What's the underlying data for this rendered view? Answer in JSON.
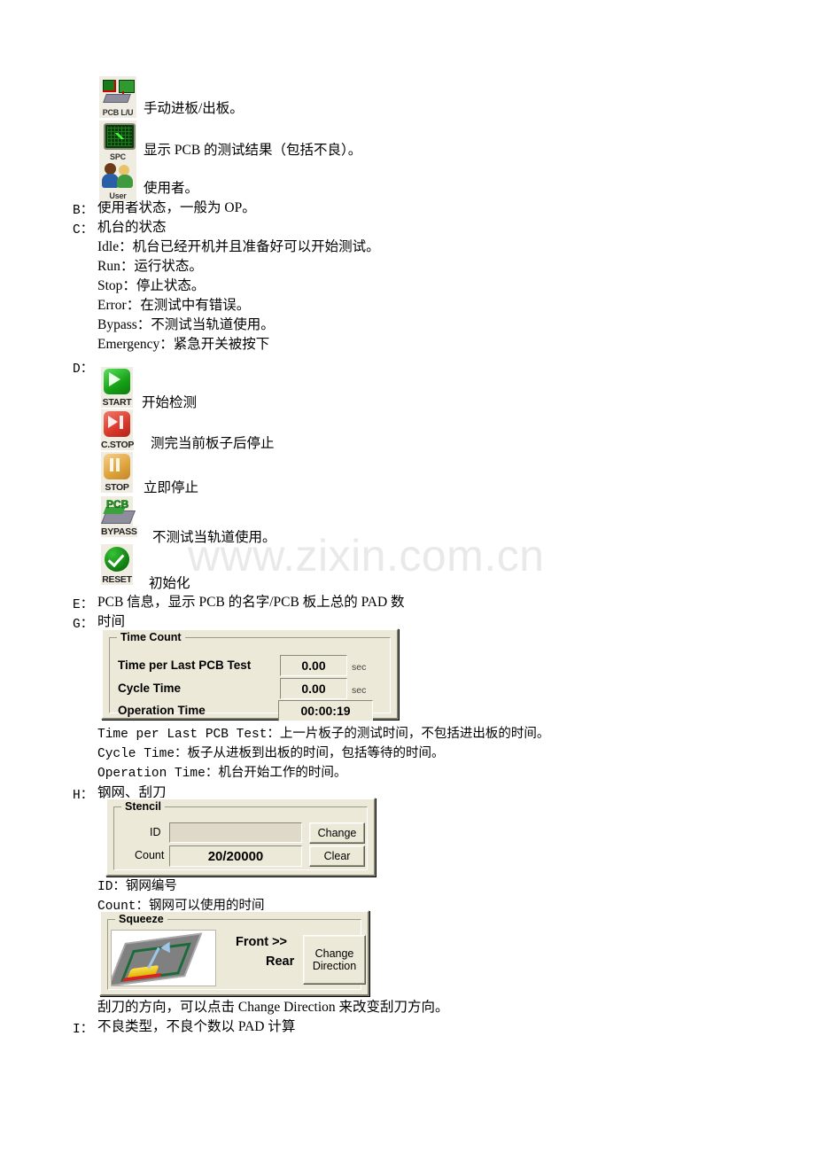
{
  "document": {
    "watermark": "www.zixin.com.cn"
  },
  "toolbar_icons": [
    {
      "caption": "PCB L/U",
      "icon": "pcb-load-unload-icon",
      "description": "手动进板/出板。"
    },
    {
      "caption": "SPC",
      "icon": "spc-chart-icon",
      "description": "显示 PCB 的测试结果（包括不良）。"
    },
    {
      "caption": "User",
      "icon": "user-accounts-icon",
      "description": "使用者。"
    }
  ],
  "sections": {
    "b": {
      "label": "B：",
      "text": "使用者状态，一般为 OP。"
    },
    "c": {
      "label": "C：",
      "title": "机台的状态",
      "states": [
        "Idle：机台已经开机并且准备好可以开始测试。",
        "Run：运行状态。",
        "Stop：停止状态。",
        "Error：在测试中有错误。",
        "Bypass：不测试当轨道使用。",
        "Emergency：紧急开关被按下"
      ]
    },
    "d": {
      "label": "D：",
      "buttons": [
        {
          "caption": "START",
          "icon": "start-button-icon",
          "description": "开始检测"
        },
        {
          "caption": "C.STOP",
          "icon": "cycle-stop-button-icon",
          "description": "测完当前板子后停止"
        },
        {
          "caption": "STOP",
          "icon": "stop-button-icon",
          "description": "立即停止"
        },
        {
          "caption": "BYPASS",
          "icon": "bypass-pcb-icon",
          "description": "不测试当轨道使用。"
        },
        {
          "caption": "RESET",
          "icon": "reset-check-icon",
          "description": "初始化"
        }
      ]
    },
    "e": {
      "label": "E：",
      "text": "PCB 信息，显示 PCB 的名字/PCB 板上总的 PAD 数"
    },
    "g": {
      "label": "G：",
      "title": "时间",
      "panel": {
        "legend": "Time Count",
        "rows": [
          {
            "label": "Time per Last PCB Test",
            "value": "0.00",
            "unit": "sec"
          },
          {
            "label": "Cycle Time",
            "value": "0.00",
            "unit": "sec"
          },
          {
            "label": "Operation Time",
            "value": "00:00:19",
            "unit": ""
          }
        ]
      },
      "notes": [
        "Time per Last PCB Test：上一片板子的测试时间，不包括进出板的时间。",
        "Cycle Time：板子从进板到出板的时间，包括等待的时间。",
        "Operation Time：机台开始工作的时间。"
      ]
    },
    "h": {
      "label": "H：",
      "title": "钢网、刮刀",
      "stencil_panel": {
        "legend": "Stencil",
        "id_label": "ID",
        "id_value": "",
        "count_label": "Count",
        "count_value": "20/20000",
        "change_button": "Change",
        "clear_button": "Clear"
      },
      "stencil_notes": [
        "ID：钢网编号",
        "Count：钢网可以使用的时间"
      ],
      "squeeze_panel": {
        "legend": "Squeeze",
        "front_label": "Front >>",
        "rear_label": "Rear",
        "change_direction_line1": "Change",
        "change_direction_line2": "Direction",
        "image_icon": "stencil-squeegee-diagram-icon"
      },
      "squeeze_note": "刮刀的方向，可以点击 Change Direction 来改变刮刀方向。"
    },
    "i": {
      "label": "I：",
      "text": "不良类型，不良个数以 PAD 计算"
    }
  },
  "colors": {
    "panel_face": "#ece9d8",
    "start_green": "#16a016",
    "cstop_red": "#d8382a",
    "stop_amber": "#dea23a",
    "reset_green": "#0f7a0f",
    "watermark_gray": "#e9e9e9"
  }
}
